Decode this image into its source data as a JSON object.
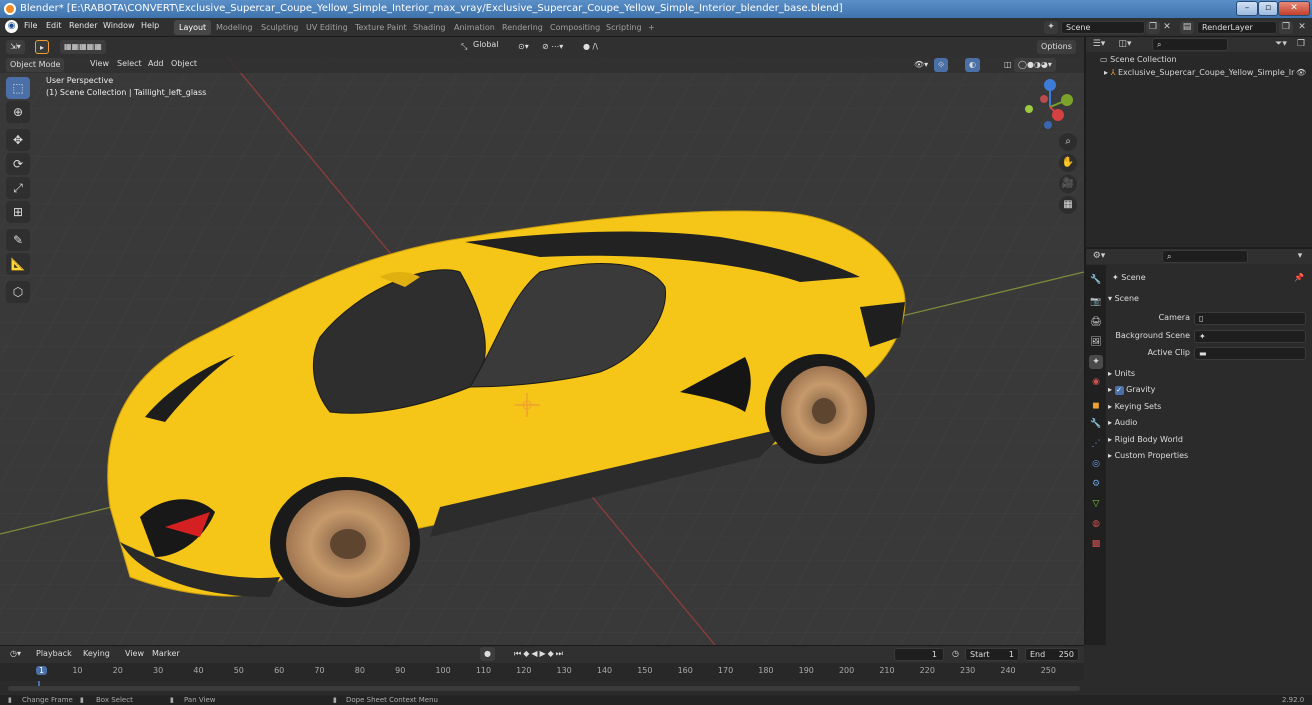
{
  "window": {
    "title": "Blender* [E:\\RABOTA\\CONVERT\\Exclusive_Supercar_Coupe_Yellow_Simple_Interior_max_vray/Exclusive_Supercar_Coupe_Yellow_Simple_Interior_blender_base.blend]",
    "min_label": "–",
    "max_label": "▫",
    "close_label": "✕"
  },
  "menu": [
    "File",
    "Edit",
    "Render",
    "Window",
    "Help"
  ],
  "workspaces": [
    {
      "label": "Layout",
      "active": true
    },
    {
      "label": "Modeling"
    },
    {
      "label": "Sculpting"
    },
    {
      "label": "UV Editing"
    },
    {
      "label": "Texture Paint"
    },
    {
      "label": "Shading"
    },
    {
      "label": "Animation"
    },
    {
      "label": "Rendering"
    },
    {
      "label": "Compositing"
    },
    {
      "label": "Scripting"
    },
    {
      "label": "+"
    }
  ],
  "scene_field": "Scene",
  "render_layer_field": "RenderLayer",
  "viewport": {
    "mode": "Object Mode",
    "menus": [
      "View",
      "Select",
      "Add",
      "Object"
    ],
    "orientation": "Global",
    "options": "Options",
    "info_line1": "User Perspective",
    "info_line2": "(1) Scene Collection | Taillight_left_glass"
  },
  "outliner": {
    "root": "Scene Collection",
    "item": "Exclusive_Supercar_Coupe_Yellow_Simple_Ir"
  },
  "properties": {
    "context": "Scene",
    "panel": "Scene",
    "rows": [
      {
        "label": "Camera"
      },
      {
        "label": "Background Scene"
      },
      {
        "label": "Active Clip"
      }
    ],
    "subpanels": [
      "Units",
      "Gravity",
      "Keying Sets",
      "Audio",
      "Rigid Body World",
      "Custom Properties"
    ]
  },
  "timeline": {
    "menus": [
      "Playback",
      "Keying",
      "View",
      "Marker"
    ],
    "current_frame": "1",
    "start_label": "Start",
    "start": "1",
    "end_label": "End",
    "end": "250",
    "ticks": [
      "1",
      "10",
      "20",
      "30",
      "40",
      "50",
      "60",
      "70",
      "80",
      "90",
      "100",
      "110",
      "120",
      "130",
      "140",
      "150",
      "160",
      "170",
      "180",
      "190",
      "200",
      "210",
      "220",
      "230",
      "240",
      "250"
    ]
  },
  "status": {
    "left": [
      "Change Frame",
      "Box Select",
      "Pan View",
      "Dope Sheet Context Menu"
    ],
    "version": "2.92.0"
  },
  "colors": {
    "accent": "#4b70a8",
    "car_body": "#f5c518",
    "viewport_bg": "#393939"
  }
}
